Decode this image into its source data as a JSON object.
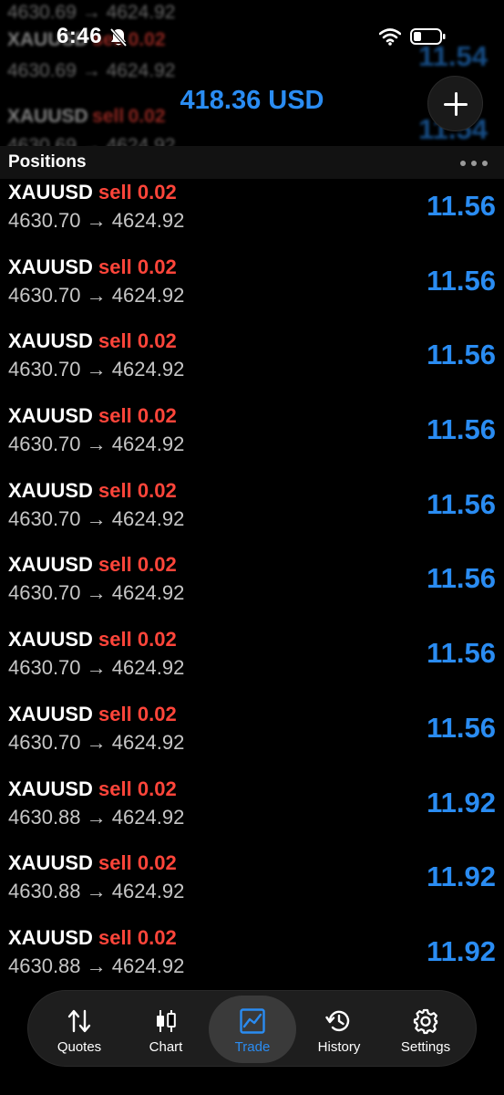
{
  "status_bar": {
    "time": "6:46",
    "icons": [
      "bell-slash-icon",
      "wifi-icon",
      "battery-icon"
    ]
  },
  "header": {
    "balance": "418.36 USD",
    "add_icon": "plus-icon"
  },
  "ghost_rows": [
    {
      "symbol": "XAUUSD",
      "side": "sell",
      "volume": "0.02",
      "prices": "4630.69 → 4624.92",
      "profit": "11.54"
    },
    {
      "symbol": "XAUUSD",
      "side": "sell",
      "volume": "0.02",
      "prices": "4630.69 → 4624.92",
      "profit": "11.54"
    }
  ],
  "section": {
    "title": "Positions",
    "more_icon": "more-dots-icon"
  },
  "positions": [
    {
      "symbol": "XAUUSD",
      "side": "sell",
      "volume": "0.02",
      "open_price": "4630.70",
      "arrow": "→",
      "current_price": "4624.92",
      "profit": "11.56"
    },
    {
      "symbol": "XAUUSD",
      "side": "sell",
      "volume": "0.02",
      "open_price": "4630.70",
      "arrow": "→",
      "current_price": "4624.92",
      "profit": "11.56"
    },
    {
      "symbol": "XAUUSD",
      "side": "sell",
      "volume": "0.02",
      "open_price": "4630.70",
      "arrow": "→",
      "current_price": "4624.92",
      "profit": "11.56"
    },
    {
      "symbol": "XAUUSD",
      "side": "sell",
      "volume": "0.02",
      "open_price": "4630.70",
      "arrow": "→",
      "current_price": "4624.92",
      "profit": "11.56"
    },
    {
      "symbol": "XAUUSD",
      "side": "sell",
      "volume": "0.02",
      "open_price": "4630.70",
      "arrow": "→",
      "current_price": "4624.92",
      "profit": "11.56"
    },
    {
      "symbol": "XAUUSD",
      "side": "sell",
      "volume": "0.02",
      "open_price": "4630.70",
      "arrow": "→",
      "current_price": "4624.92",
      "profit": "11.56"
    },
    {
      "symbol": "XAUUSD",
      "side": "sell",
      "volume": "0.02",
      "open_price": "4630.70",
      "arrow": "→",
      "current_price": "4624.92",
      "profit": "11.56"
    },
    {
      "symbol": "XAUUSD",
      "side": "sell",
      "volume": "0.02",
      "open_price": "4630.70",
      "arrow": "→",
      "current_price": "4624.92",
      "profit": "11.56"
    },
    {
      "symbol": "XAUUSD",
      "side": "sell",
      "volume": "0.02",
      "open_price": "4630.88",
      "arrow": "→",
      "current_price": "4624.92",
      "profit": "11.92"
    },
    {
      "symbol": "XAUUSD",
      "side": "sell",
      "volume": "0.02",
      "open_price": "4630.88",
      "arrow": "→",
      "current_price": "4624.92",
      "profit": "11.92"
    },
    {
      "symbol": "XAUUSD",
      "side": "sell",
      "volume": "0.02",
      "open_price": "4630.88",
      "arrow": "→",
      "current_price": "4624.92",
      "profit": "11.92"
    }
  ],
  "tabs": [
    {
      "label": "Quotes",
      "icon": "quotes-arrows-icon",
      "active": false
    },
    {
      "label": "Chart",
      "icon": "candlestick-chart-icon",
      "active": false
    },
    {
      "label": "Trade",
      "icon": "trade-chart-icon",
      "active": true
    },
    {
      "label": "History",
      "icon": "history-clock-icon",
      "active": false
    },
    {
      "label": "Settings",
      "icon": "settings-gear-icon",
      "active": false
    }
  ],
  "colors": {
    "accent_blue": "#2a8cf2",
    "sell_red": "#ff453a",
    "background": "#000000"
  }
}
